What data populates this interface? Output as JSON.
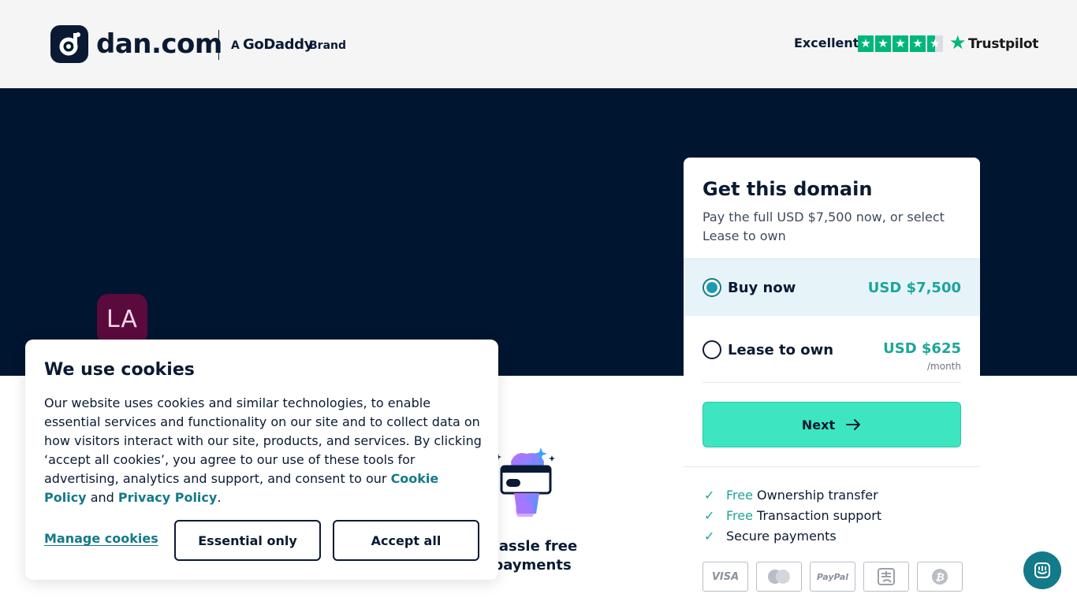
{
  "header": {
    "logo_text": "dan.com",
    "brand_prefix": "A",
    "brand_name": "GoDaddy",
    "brand_suffix": "Brand",
    "trustpilot_rating": "Excellent",
    "trustpilot_name": "Trustpilot",
    "trustpilot_stars": 4.5
  },
  "hero": {
    "avatar_initials": "LA"
  },
  "feature": {
    "title": "Hassle free payments",
    "icon": "card-payment-icon"
  },
  "card": {
    "title": "Get this domain",
    "subtitle": "Pay the full USD $7,500 now, or select Lease to own",
    "buy_now_label": "Buy now",
    "buy_now_price": "USD $7,500",
    "lease_label": "Lease to own",
    "lease_price": "USD $625",
    "lease_unit": "/month",
    "next_label": "Next",
    "perks": [
      {
        "free": "Free",
        "text": "Ownership transfer"
      },
      {
        "free": "Free",
        "text": "Transaction support"
      },
      {
        "free": "",
        "text": "Secure payments"
      }
    ],
    "payment_methods": [
      "VISA",
      "mastercard-icon",
      "PayPal",
      "alipay-icon",
      "bitcoin-icon"
    ]
  },
  "cookie": {
    "title": "We use cookies",
    "body": "Our website uses cookies and similar technologies, to enable essential services and functionality on our site and to collect data on how visitors interact with our site, products, and services. By clicking ‘accept all cookies’, you agree to our use of these tools for advertising, analytics and support, and consent to our",
    "cookie_policy": "Cookie Policy",
    "and": "and",
    "privacy_policy": "Privacy Policy",
    "period": ".",
    "manage_label": "Manage cookies",
    "essential_label": "Essential only",
    "accept_label": "Accept all"
  },
  "colors": {
    "hero_bg": "#001530",
    "accent": "#1ea59a",
    "next_button": "#3de6c0",
    "trustpilot_green": "#00b67a",
    "link": "#137a8a"
  }
}
